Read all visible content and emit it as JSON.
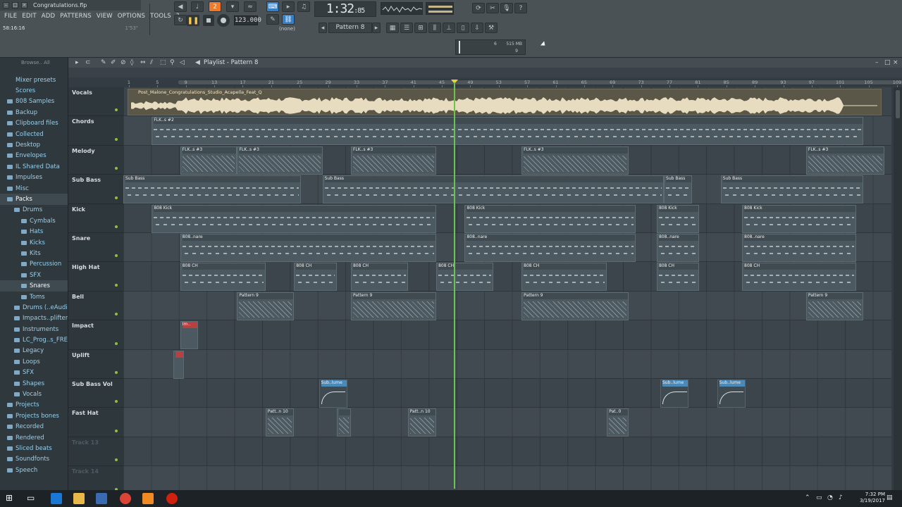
{
  "window": {
    "title": "Congratulations.flp"
  },
  "menu": [
    "FILE",
    "EDIT",
    "ADD",
    "PATTERNS",
    "VIEW",
    "OPTIONS",
    "TOOLS",
    "?"
  ],
  "hint": {
    "left": "58:16:16",
    "right": "1'53\""
  },
  "transport": {
    "mode_label": "2",
    "tempo": "123.000",
    "time_main": "1:32",
    "time_sub": "85",
    "pattern": "Pattern 8",
    "pattern_none": "(none)",
    "memory": "515 MB",
    "poly": "6",
    "cpu": "9"
  },
  "browser": {
    "header": "Browse.. All",
    "items": [
      {
        "label": "Mixer presets",
        "folder": false,
        "indent": 0
      },
      {
        "label": "Scores",
        "folder": false,
        "indent": 0
      },
      {
        "label": "808 Samples",
        "folder": true,
        "indent": 0
      },
      {
        "label": "Backup",
        "folder": true,
        "indent": 0
      },
      {
        "label": "Clipboard files",
        "folder": true,
        "indent": 0
      },
      {
        "label": "Collected",
        "folder": true,
        "indent": 0
      },
      {
        "label": "Desktop",
        "folder": true,
        "indent": 0
      },
      {
        "label": "Envelopes",
        "folder": true,
        "indent": 0
      },
      {
        "label": "IL Shared Data",
        "folder": true,
        "indent": 0
      },
      {
        "label": "Impulses",
        "folder": true,
        "indent": 0
      },
      {
        "label": "Misc",
        "folder": true,
        "indent": 0
      },
      {
        "label": "Packs",
        "folder": true,
        "indent": 0,
        "selected": true
      },
      {
        "label": "Drums",
        "folder": true,
        "indent": 1
      },
      {
        "label": "Cymbals",
        "folder": true,
        "indent": 2
      },
      {
        "label": "Hats",
        "folder": true,
        "indent": 2
      },
      {
        "label": "Kicks",
        "folder": true,
        "indent": 2
      },
      {
        "label": "Kits",
        "folder": true,
        "indent": 2
      },
      {
        "label": "Percussion",
        "folder": true,
        "indent": 2
      },
      {
        "label": "SFX",
        "folder": true,
        "indent": 2
      },
      {
        "label": "Snares",
        "folder": true,
        "indent": 2,
        "selected": true
      },
      {
        "label": "Toms",
        "folder": true,
        "indent": 2
      },
      {
        "label": "Drums (..eAudio)",
        "folder": true,
        "indent": 1
      },
      {
        "label": "Impacts..plifters",
        "folder": true,
        "indent": 1
      },
      {
        "label": "Instruments",
        "folder": true,
        "indent": 1
      },
      {
        "label": "LC_Prog..s_FREE",
        "folder": true,
        "indent": 1
      },
      {
        "label": "Legacy",
        "folder": true,
        "indent": 1
      },
      {
        "label": "Loops",
        "folder": true,
        "indent": 1
      },
      {
        "label": "SFX",
        "folder": true,
        "indent": 1
      },
      {
        "label": "Shapes",
        "folder": true,
        "indent": 1
      },
      {
        "label": "Vocals",
        "folder": true,
        "indent": 1
      },
      {
        "label": "Projects",
        "folder": true,
        "indent": 0
      },
      {
        "label": "Projects bones",
        "folder": true,
        "indent": 0
      },
      {
        "label": "Recorded",
        "folder": true,
        "indent": 0
      },
      {
        "label": "Rendered",
        "folder": true,
        "indent": 0
      },
      {
        "label": "Sliced beats",
        "folder": true,
        "indent": 0
      },
      {
        "label": "Soundfonts",
        "folder": true,
        "indent": 0
      },
      {
        "label": "Speech",
        "folder": true,
        "indent": 0
      }
    ]
  },
  "playlist": {
    "title": "Playlist - Pattern 8",
    "bars": [
      1,
      5,
      9,
      13,
      17,
      21,
      25,
      29,
      33,
      37,
      41,
      45,
      49,
      53,
      57,
      61,
      65,
      69,
      73,
      77,
      81,
      85,
      89,
      93,
      97,
      101,
      105,
      109
    ],
    "tracks": [
      {
        "name": "Vocals",
        "dim": false
      },
      {
        "name": "Chords",
        "dim": false
      },
      {
        "name": "Melody",
        "dim": false
      },
      {
        "name": "Sub Bass",
        "dim": false
      },
      {
        "name": "Kick",
        "dim": false
      },
      {
        "name": "Snare",
        "dim": false
      },
      {
        "name": "High Hat",
        "dim": false
      },
      {
        "name": "Bell",
        "dim": false
      },
      {
        "name": "Impact",
        "dim": false
      },
      {
        "name": "Uplift",
        "dim": false
      },
      {
        "name": "Sub Bass Vol",
        "dim": false
      },
      {
        "name": "Fast Hat",
        "dim": false
      },
      {
        "name": "Track 13",
        "dim": true
      },
      {
        "name": "Track 14",
        "dim": true
      }
    ],
    "audio_clip_name": "Post_Malone_Congratulations_Studio_Acapella_Feat_Q",
    "clips": [
      {
        "track": 1,
        "start": 5,
        "len": 100,
        "label": "FLK..s #2",
        "kind": "dash"
      },
      {
        "track": 2,
        "start": 9,
        "len": 8,
        "label": "FLK..s #3",
        "kind": "pat"
      },
      {
        "track": 2,
        "start": 17,
        "len": 12,
        "label": "FLK..s #3",
        "kind": "pat"
      },
      {
        "track": 2,
        "start": 33,
        "len": 12,
        "label": "FLK..s #3",
        "kind": "pat"
      },
      {
        "track": 2,
        "start": 57,
        "len": 15,
        "label": "FLK..s #3",
        "kind": "pat"
      },
      {
        "track": 2,
        "start": 97,
        "len": 11,
        "label": "FLK..s #3",
        "kind": "pat"
      },
      {
        "track": 3,
        "start": 1,
        "len": 25,
        "label": "Sub Bass",
        "kind": "dash"
      },
      {
        "track": 3,
        "start": 29,
        "len": 48,
        "label": "Sub Bass",
        "kind": "dash"
      },
      {
        "track": 3,
        "start": 77,
        "len": 4,
        "label": "Sub Bass",
        "kind": "dash"
      },
      {
        "track": 3,
        "start": 85,
        "len": 20,
        "label": "Sub Bass",
        "kind": "dash"
      },
      {
        "track": 4,
        "start": 5,
        "len": 40,
        "label": "808 Kick",
        "kind": "dash"
      },
      {
        "track": 4,
        "start": 49,
        "len": 24,
        "label": "808 Kick",
        "kind": "dash"
      },
      {
        "track": 4,
        "start": 76,
        "len": 6,
        "label": "808 Kick",
        "kind": "dash"
      },
      {
        "track": 4,
        "start": 88,
        "len": 16,
        "label": "808 Kick",
        "kind": "dash"
      },
      {
        "track": 5,
        "start": 9,
        "len": 36,
        "label": "808..nare",
        "kind": "dash"
      },
      {
        "track": 5,
        "start": 49,
        "len": 24,
        "label": "808..nare",
        "kind": "dash"
      },
      {
        "track": 5,
        "start": 76,
        "len": 6,
        "label": "808..nare",
        "kind": "dash"
      },
      {
        "track": 5,
        "start": 88,
        "len": 16,
        "label": "808..nare",
        "kind": "dash"
      },
      {
        "track": 6,
        "start": 9,
        "len": 12,
        "label": "808 CH",
        "kind": "dash"
      },
      {
        "track": 6,
        "start": 25,
        "len": 6,
        "label": "808 CH",
        "kind": "dash"
      },
      {
        "track": 6,
        "start": 33,
        "len": 8,
        "label": "808 CH",
        "kind": "dash"
      },
      {
        "track": 6,
        "start": 45,
        "len": 8,
        "label": "808 CH",
        "kind": "dash"
      },
      {
        "track": 6,
        "start": 57,
        "len": 12,
        "label": "808 CH",
        "kind": "dash"
      },
      {
        "track": 6,
        "start": 76,
        "len": 6,
        "label": "808 CH",
        "kind": "dash"
      },
      {
        "track": 6,
        "start": 88,
        "len": 16,
        "label": "808 CH",
        "kind": "dash"
      },
      {
        "track": 7,
        "start": 17,
        "len": 8,
        "label": "Pattern 9",
        "kind": "pat"
      },
      {
        "track": 7,
        "start": 33,
        "len": 12,
        "label": "Pattern 9",
        "kind": "pat"
      },
      {
        "track": 7,
        "start": 57,
        "len": 15,
        "label": "Pattern 9",
        "kind": "pat"
      },
      {
        "track": 7,
        "start": 97,
        "len": 8,
        "label": "Pattern 9",
        "kind": "pat"
      },
      {
        "track": 8,
        "start": 9,
        "len": 2.5,
        "label": "Im..",
        "kind": "red"
      },
      {
        "track": 9,
        "start": 8,
        "len": 1.5,
        "label": "",
        "kind": "red"
      },
      {
        "track": 10,
        "start": 28.5,
        "len": 4,
        "label": "Sub..lume",
        "kind": "auto"
      },
      {
        "track": 10,
        "start": 76.5,
        "len": 4,
        "label": "Sub..lume",
        "kind": "auto"
      },
      {
        "track": 10,
        "start": 84.5,
        "len": 4,
        "label": "Sub..lume",
        "kind": "auto"
      },
      {
        "track": 11,
        "start": 21,
        "len": 4,
        "label": "Patt..n 10",
        "kind": "pat"
      },
      {
        "track": 11,
        "start": 31,
        "len": 2,
        "label": "",
        "kind": "pat"
      },
      {
        "track": 11,
        "start": 41,
        "len": 4,
        "label": "Patt..n 10",
        "kind": "pat"
      },
      {
        "track": 11,
        "start": 69,
        "len": 3,
        "label": "Pat..0",
        "kind": "pat"
      }
    ]
  },
  "taskbar": {
    "time": "7:32 PM",
    "date": "3/19/2017"
  },
  "colors": {
    "accent": "#f07a2a",
    "playhead": "#6ac64a",
    "browser_text": "#9ad0ec"
  }
}
